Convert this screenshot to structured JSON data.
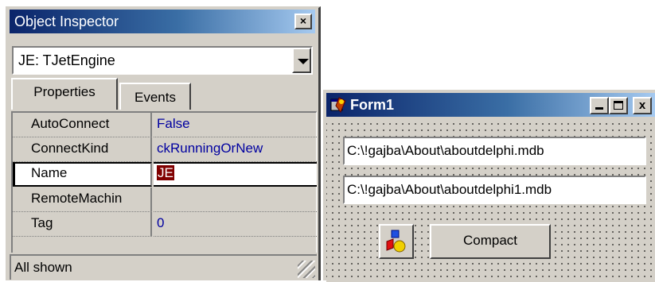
{
  "object_inspector": {
    "title": "Object Inspector",
    "close_glyph": "×",
    "selected_component": "JE: TJetEngine",
    "tabs": [
      {
        "label": "Properties",
        "active": true
      },
      {
        "label": "Events",
        "active": false
      }
    ],
    "properties": [
      {
        "name": "AutoConnect",
        "value": "False"
      },
      {
        "name": "ConnectKind",
        "value": "ckRunningOrNew"
      },
      {
        "name": "Name",
        "value": "JE",
        "selected": true
      },
      {
        "name": "RemoteMachin",
        "value": ""
      },
      {
        "name": "Tag",
        "value": "0"
      }
    ],
    "status": "All shown"
  },
  "form1": {
    "title": "Form1",
    "close_glyph": "x",
    "edit1": "C:\\!gajba\\About\\aboutdelphi.mdb",
    "edit2": "C:\\!gajba\\About\\aboutdelphi1.mdb",
    "button_label": "Compact"
  },
  "colors": {
    "title_bar_start": "#0a246a",
    "title_bar_end": "#a6caf0",
    "face": "#d4d0c8",
    "property_value": "#0000a0",
    "selection_chip": "#800000"
  },
  "icons": [
    "close-icon",
    "dropdown-arrow-icon",
    "size-grip-icon",
    "delphi-form-icon",
    "minimize-icon",
    "maximize-icon",
    "jet-engine-component-icon"
  ]
}
